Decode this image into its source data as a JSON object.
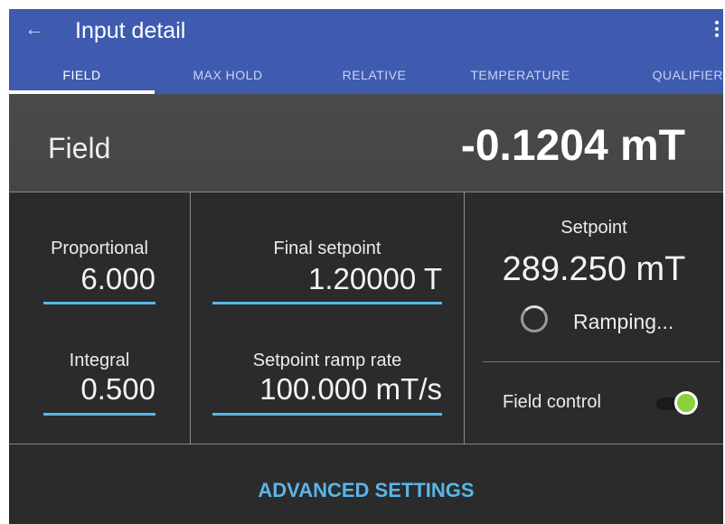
{
  "header": {
    "title": "Input detail",
    "back_icon": "arrow-left-icon",
    "menu_icon": "more-vert-icon"
  },
  "tabs": [
    {
      "label": "FIELD",
      "active": true
    },
    {
      "label": "MAX HOLD",
      "active": false
    },
    {
      "label": "RELATIVE",
      "active": false
    },
    {
      "label": "TEMPERATURE",
      "active": false
    },
    {
      "label": "QUALIFIER",
      "active": false
    }
  ],
  "reading": {
    "label": "Field",
    "value": "-0.1204 mT"
  },
  "pid": {
    "proportional_label": "Proportional",
    "proportional_value": "6.000",
    "integral_label": "Integral",
    "integral_value": "0.500"
  },
  "setpoint_config": {
    "final_label": "Final setpoint",
    "final_value": "1.20000 T",
    "ramp_label": "Setpoint ramp rate",
    "ramp_value": "100.000 mT/s"
  },
  "status": {
    "setpoint_label": "Setpoint",
    "setpoint_value": "289.250 mT",
    "ramping_text": "Ramping...",
    "control_label": "Field control",
    "control_on": true
  },
  "footer": {
    "advanced_label": "ADVANCED SETTINGS"
  },
  "colors": {
    "appbar": "#3e5bb0",
    "accent": "#5ab6e6",
    "toggle_on": "#8ad13b",
    "background": "#2b2b2b"
  }
}
